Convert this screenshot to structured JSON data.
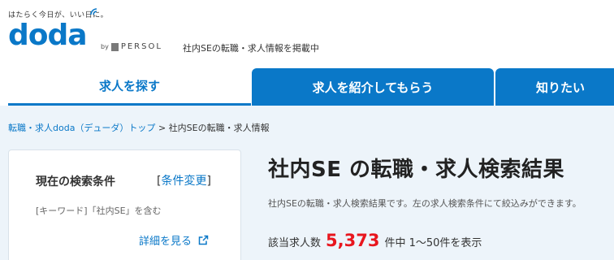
{
  "header": {
    "tagline": "はたらく今日が、いい日に。",
    "logo_text": "doda",
    "by_text": "by",
    "persol_text": "PERSOL",
    "caption": "社内SEの転職・求人情報を掲載中"
  },
  "nav": {
    "tabs": [
      {
        "label": "求人を探す",
        "active": true
      },
      {
        "label": "求人を紹介してもらう",
        "active": false
      },
      {
        "label": "知りたい",
        "active": false
      }
    ]
  },
  "breadcrumb": {
    "link": "転職・求人doda（デューダ）トップ",
    "separator": ">",
    "current": "社内SEの転職・求人情報"
  },
  "conditions": {
    "title": "現在の検索条件",
    "change_open": "[",
    "change_label": "条件変更",
    "change_close": "]",
    "description": "[キーワード]「社内SE」を含む",
    "detail_label": "詳細を見る"
  },
  "results": {
    "title": "社内SE の転職・求人検索結果",
    "description": "社内SEの転職・求人検索結果です。左の求人検索条件にて絞込みができます。",
    "count_label": "該当求人数",
    "count": "5,373",
    "count_suffix": "件中 1〜50件を表示"
  },
  "colors": {
    "brand_blue": "#0a78c8",
    "count_red": "#e8161e",
    "content_bg": "#edf4fa"
  }
}
